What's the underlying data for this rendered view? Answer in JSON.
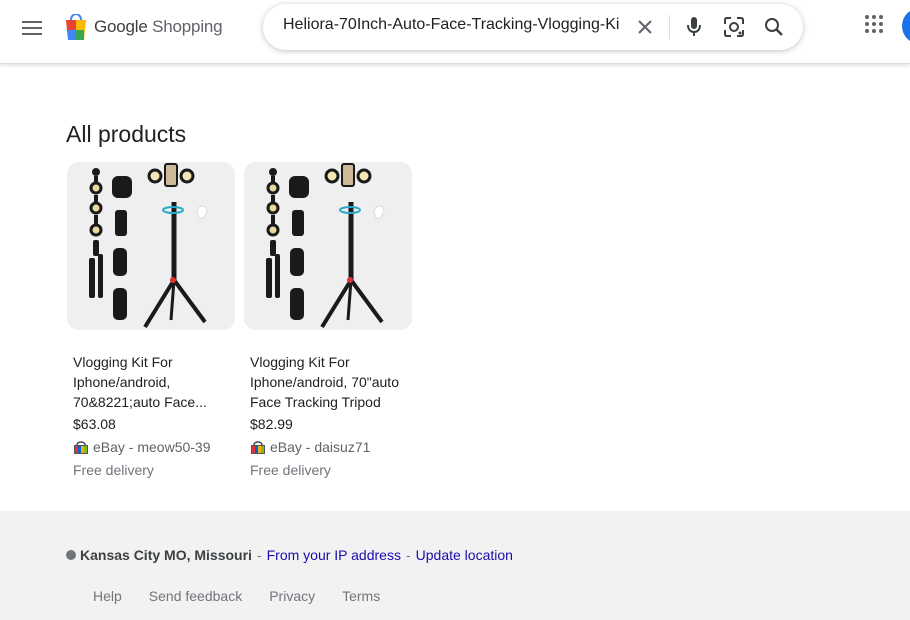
{
  "header": {
    "logo_text_1": "Google",
    "logo_text_2": "Shopping",
    "search_value": "Heliora-70Inch-Auto-Face-Tracking-Vlogging-Ki",
    "icons": [
      "menu-icon",
      "shopping-bag-logo",
      "close-icon",
      "mic-icon",
      "lens-icon",
      "search-icon",
      "apps-icon"
    ]
  },
  "main": {
    "section_title": "All products",
    "products": [
      {
        "title": "Vlogging Kit For Iphone/android, 70&8221;auto Face...",
        "price": "$63.08",
        "seller": "eBay - meow50-39",
        "delivery": "Free delivery"
      },
      {
        "title": "Vlogging Kit For Iphone/android, 70\"auto Face Tracking Tripod",
        "price": "$82.99",
        "seller": "eBay - daisuz71",
        "delivery": "Free delivery"
      }
    ]
  },
  "footer": {
    "location": "Kansas City MO, Missouri",
    "sep": "-",
    "ip_link": "From your IP address",
    "update_link": "Update location",
    "links": [
      "Help",
      "Send feedback",
      "Privacy",
      "Terms"
    ]
  },
  "colors": {
    "link": "#1a0dab",
    "footer_bg": "#f2f2f2",
    "avatar": "#1a73e8"
  }
}
